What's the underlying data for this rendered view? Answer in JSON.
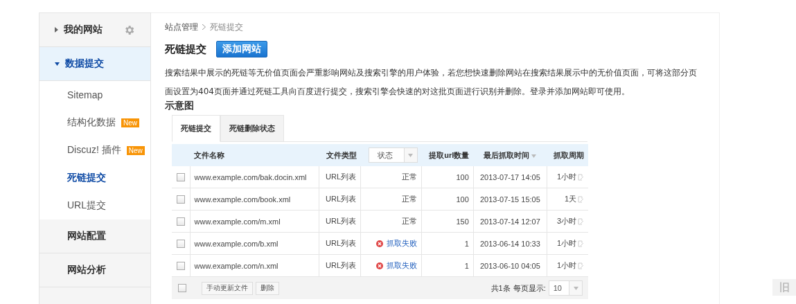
{
  "sidebar": {
    "items": [
      {
        "kind": "site",
        "label": "我的网站",
        "expanded": false,
        "selected": false
      },
      {
        "kind": "group",
        "label": "数据提交",
        "expanded": true,
        "selected": true,
        "children": [
          {
            "label": "Sitemap",
            "selected": false
          },
          {
            "label": "结构化数据",
            "selected": false,
            "badge": "New"
          },
          {
            "label": "Discuz! 插件",
            "selected": false,
            "badge": "New"
          },
          {
            "label": "死链提交",
            "selected": true
          },
          {
            "label": "URL提交",
            "selected": false
          }
        ]
      },
      {
        "kind": "plain",
        "label": "网站配置",
        "selected": false
      },
      {
        "kind": "plain",
        "label": "网站分析",
        "selected": false
      }
    ]
  },
  "breadcrumb": [
    "站点管理",
    "死链提交"
  ],
  "title": "死链提交",
  "add_button": "添加网站",
  "description": "搜索结果中展示的死链等无价值页面会严重影响网站及搜索引擎的用户体验，若您想快速删除网站在搜索结果展示中的无价值页面，可将这部分页面设置为404页面并通过死链工具向百度进行提交，搜索引擎会快速的对这批页面进行识别并删除。登录并添加网站即可使用。",
  "example_heading": "示意图",
  "tabs": [
    {
      "label": "死链提交",
      "selected": true
    },
    {
      "label": "死链删除状态",
      "selected": false
    }
  ],
  "table": {
    "columns": [
      "文件名称",
      "文件类型",
      "状态",
      "提取url数量",
      "最后抓取时间",
      "抓取周期"
    ],
    "rows": [
      {
        "checked": false,
        "file": "www.example.com/bak.docin.xml",
        "type": "URL列表",
        "failed": false,
        "status": "正常",
        "count": "100",
        "time": "2013-07-17 14:05",
        "period": "1小时"
      },
      {
        "checked": false,
        "file": "www.example.com/book.xml",
        "type": "URL列表",
        "failed": false,
        "status": "正常",
        "count": "100",
        "time": "2013-07-15 15:05",
        "period": "1天"
      },
      {
        "checked": false,
        "file": "www.example.com/m.xml",
        "type": "URL列表",
        "failed": false,
        "status": "正常",
        "count": "150",
        "time": "2013-07-14 12:07",
        "period": "3小时"
      },
      {
        "checked": false,
        "file": "www.example.com/b.xml",
        "type": "URL列表",
        "failed": true,
        "status": "抓取失败",
        "count": "1",
        "time": "2013-06-14 10:33",
        "period": "1小时"
      },
      {
        "checked": false,
        "file": "www.example.com/n.xml",
        "type": "URL列表",
        "failed": true,
        "status": "抓取失败",
        "count": "1",
        "time": "2013-06-10 04:05",
        "period": "1小时"
      }
    ],
    "footer": {
      "checked": false,
      "buttons": [
        "手动更新文件",
        "删除"
      ],
      "total": "共1条",
      "page_size_label": "每页显示:",
      "page_size": "10"
    }
  },
  "old_version_tab": "旧"
}
